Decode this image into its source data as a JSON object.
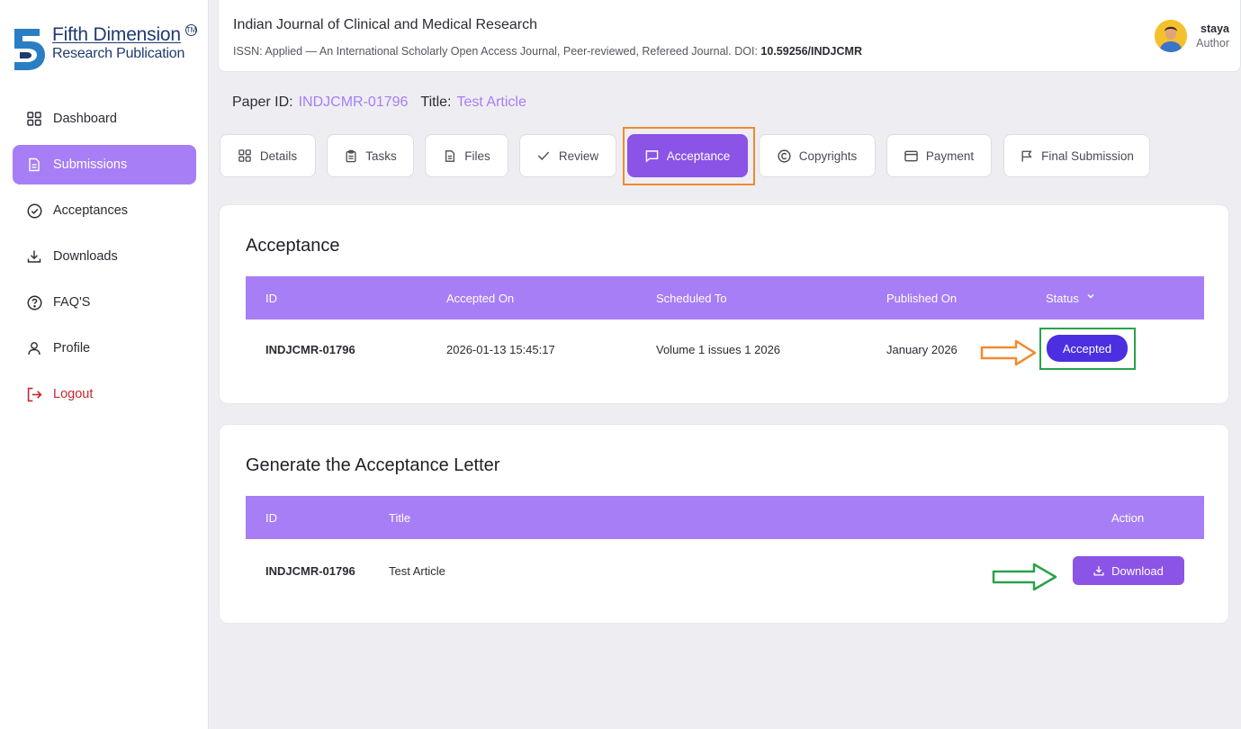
{
  "brand": {
    "line1": "Fifth Dimension",
    "line2": "Research Publication",
    "tm": "TM"
  },
  "sidebar": {
    "items": [
      {
        "label": "Dashboard",
        "icon": "grid-icon"
      },
      {
        "label": "Submissions",
        "icon": "document-icon"
      },
      {
        "label": "Acceptances",
        "icon": "check-circle-icon"
      },
      {
        "label": "Downloads",
        "icon": "download-icon"
      },
      {
        "label": "FAQ'S",
        "icon": "help-circle-icon"
      },
      {
        "label": "Profile",
        "icon": "user-icon"
      },
      {
        "label": "Logout",
        "icon": "logout-icon"
      }
    ]
  },
  "header": {
    "journal_title": "Indian Journal of Clinical and Medical Research",
    "journal_sub": "ISSN: Applied — An International Scholarly Open Access Journal, Peer-reviewed, Refereed Journal. DOI: ",
    "doi": "10.59256/INDJCMR",
    "user_name": "staya",
    "user_role": "Author"
  },
  "paper": {
    "id_label": "Paper ID:",
    "id_value": "INDJCMR-01796",
    "title_label": "Title:",
    "title_value": "Test Article"
  },
  "tabs": [
    {
      "label": "Details",
      "icon": "grid-icon"
    },
    {
      "label": "Tasks",
      "icon": "clipboard-icon"
    },
    {
      "label": "Files",
      "icon": "file-icon"
    },
    {
      "label": "Review",
      "icon": "check-icon"
    },
    {
      "label": "Acceptance",
      "icon": "message-icon"
    },
    {
      "label": "Copyrights",
      "icon": "copyright-icon"
    },
    {
      "label": "Payment",
      "icon": "credit-card-icon"
    },
    {
      "label": "Final Submission",
      "icon": "flag-icon"
    }
  ],
  "acceptance": {
    "title": "Acceptance",
    "columns": [
      "ID",
      "Accepted On",
      "Scheduled To",
      "Published On",
      "Status"
    ],
    "row": {
      "id": "INDJCMR-01796",
      "accepted_on": "2026-01-13 15:45:17",
      "scheduled_to": "Volume 1 issues 1 2026",
      "published_on": "January 2026",
      "status": "Accepted"
    }
  },
  "letter": {
    "title": "Generate the Acceptance Letter",
    "columns": [
      "ID",
      "Title",
      "Action"
    ],
    "row": {
      "id": "INDJCMR-01796",
      "title": "Test Article",
      "action": "Download"
    }
  },
  "colors": {
    "accent": "#a77ef5",
    "accent_dark": "#8b53e6",
    "badge": "#4b2fe0",
    "highlight_orange": "#f28a2f",
    "highlight_green": "#2aa24a",
    "logout": "#c5282d"
  }
}
